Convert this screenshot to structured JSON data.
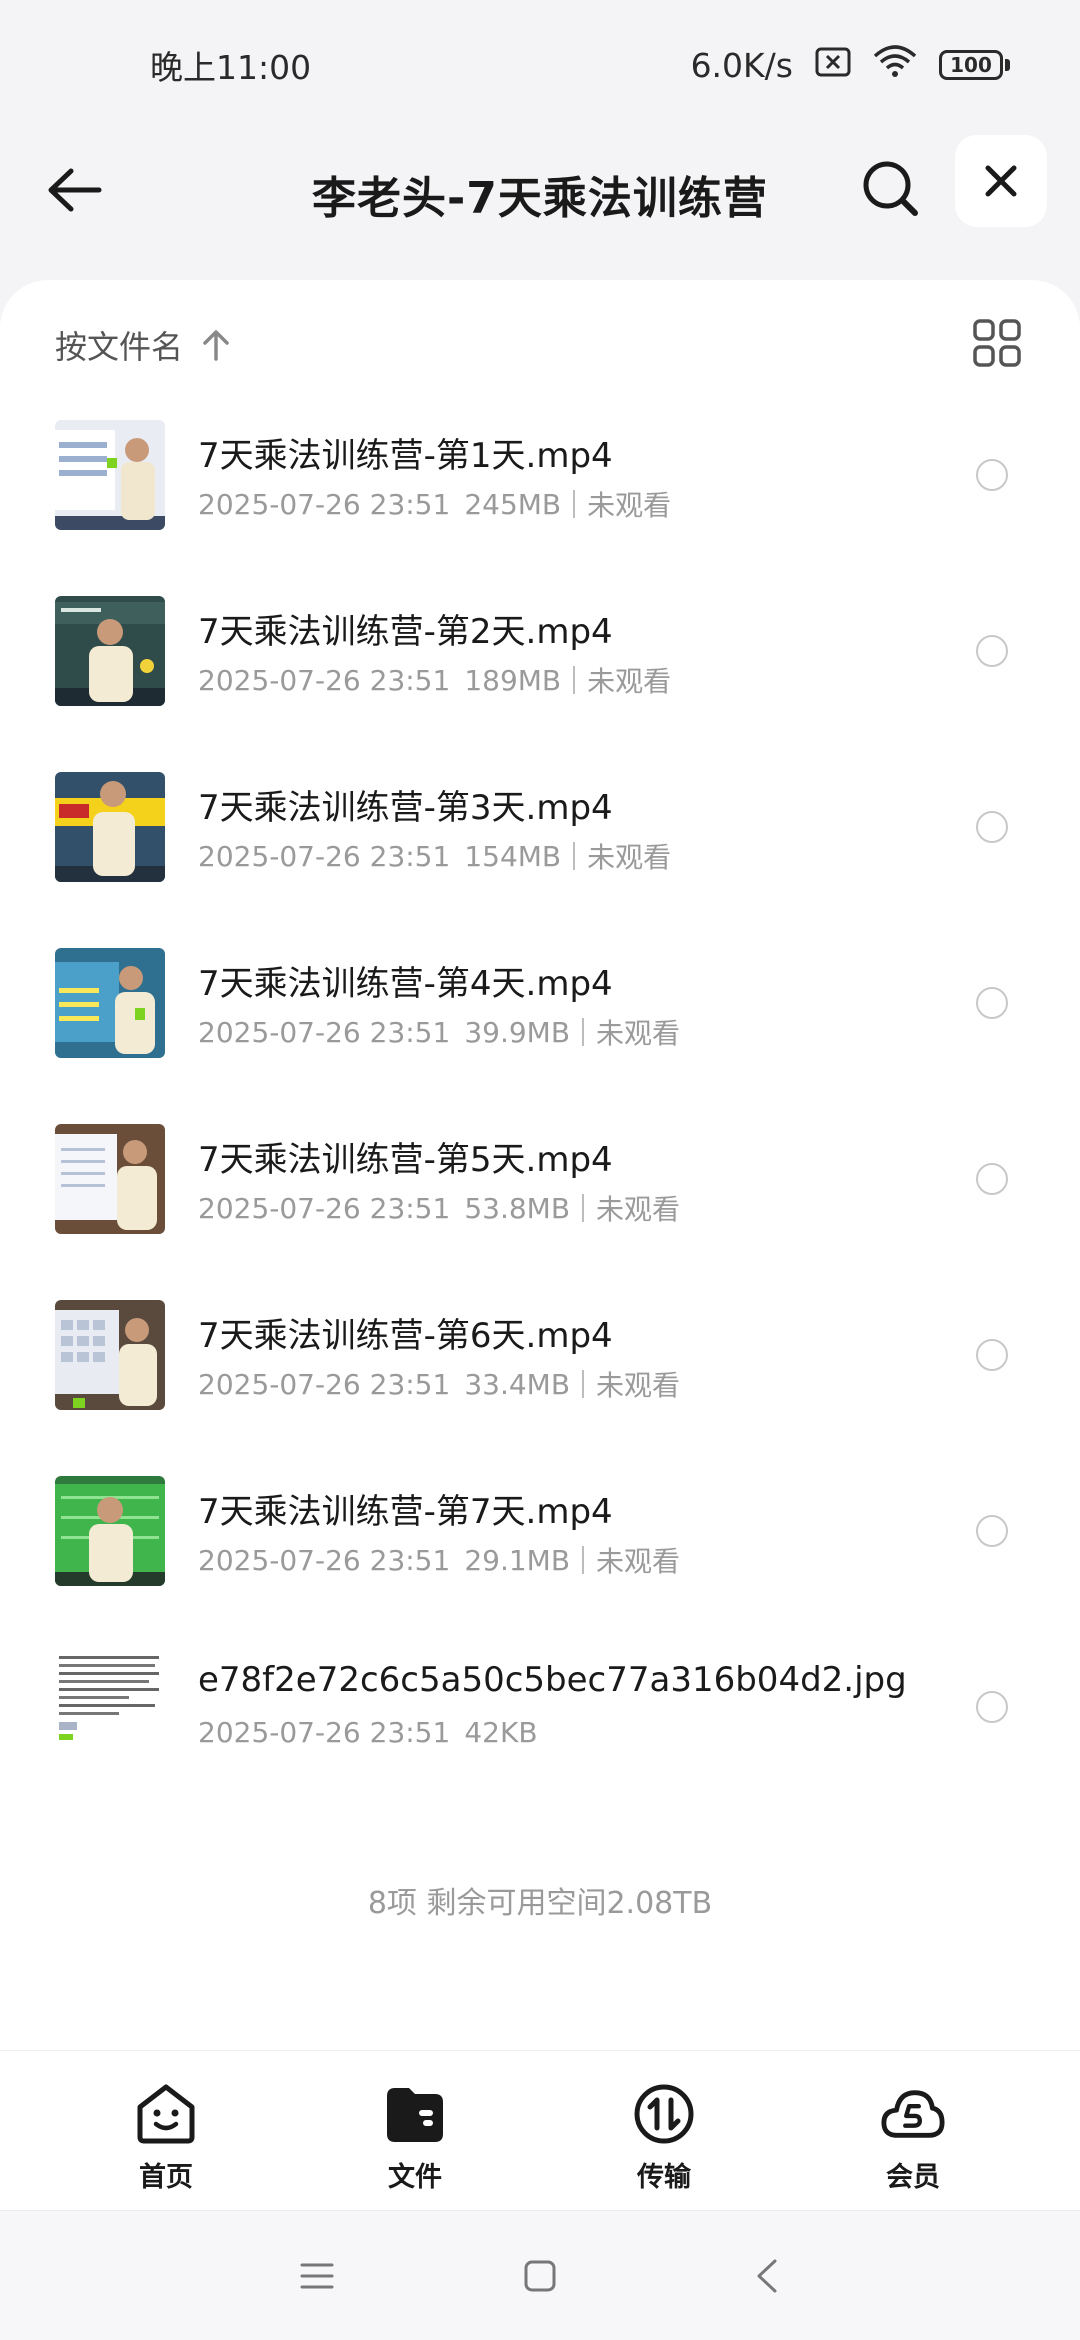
{
  "status_bar": {
    "time": "晚上11:00",
    "speed": "6.0K/s",
    "battery": "100"
  },
  "header": {
    "title": "李老头-7天乘法训练营"
  },
  "sort": {
    "label": "按文件名"
  },
  "files": [
    {
      "name": "7天乘法训练营-第1天.mp4",
      "date": "2025-07-26 23:51",
      "size": "245MB",
      "status": "未观看"
    },
    {
      "name": "7天乘法训练营-第2天.mp4",
      "date": "2025-07-26 23:51",
      "size": "189MB",
      "status": "未观看"
    },
    {
      "name": "7天乘法训练营-第3天.mp4",
      "date": "2025-07-26 23:51",
      "size": "154MB",
      "status": "未观看"
    },
    {
      "name": "7天乘法训练营-第4天.mp4",
      "date": "2025-07-26 23:51",
      "size": "39.9MB",
      "status": "未观看"
    },
    {
      "name": "7天乘法训练营-第5天.mp4",
      "date": "2025-07-26 23:51",
      "size": "53.8MB",
      "status": "未观看"
    },
    {
      "name": "7天乘法训练营-第6天.mp4",
      "date": "2025-07-26 23:51",
      "size": "33.4MB",
      "status": "未观看"
    },
    {
      "name": "7天乘法训练营-第7天.mp4",
      "date": "2025-07-26 23:51",
      "size": "29.1MB",
      "status": "未观看"
    },
    {
      "name": "e78f2e72c6c5a50c5bec77a316b04d2.jpg",
      "date": "2025-07-26 23:51",
      "size": "42KB"
    }
  ],
  "summary": "8项 剩余可用空间2.08TB",
  "bottom_nav": {
    "home": "首页",
    "files": "文件",
    "transfer": "传输",
    "member": "会员"
  },
  "colors": {
    "background": "#f4f4f6",
    "card": "#ffffff",
    "text_primary": "#1a1a1a",
    "text_secondary": "#9a9a9a"
  }
}
